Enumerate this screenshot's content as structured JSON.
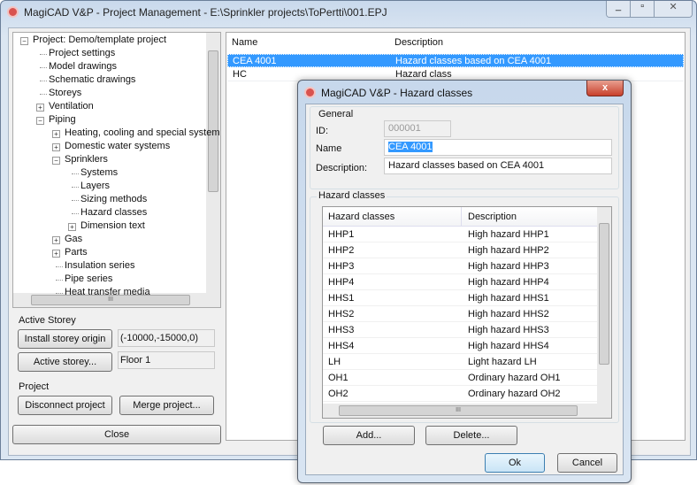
{
  "main_window": {
    "title": "MagiCAD V&P - Project Management - E:\\Sprinkler projects\\ToPertti\\001.EPJ",
    "min": "_",
    "max": "▫",
    "close": "✕"
  },
  "tree": {
    "items": [
      {
        "label": "Project: Demo/template project",
        "level": 0,
        "exp": "−"
      },
      {
        "label": "Project settings",
        "level": 1
      },
      {
        "label": "Model drawings",
        "level": 1
      },
      {
        "label": "Schematic drawings",
        "level": 1
      },
      {
        "label": "Storeys",
        "level": 1
      },
      {
        "label": "Ventilation",
        "level": 1,
        "exp": "+"
      },
      {
        "label": "Piping",
        "level": 1,
        "exp": "−"
      },
      {
        "label": "Heating, cooling and special system",
        "level": 2,
        "exp": "+"
      },
      {
        "label": "Domestic water systems",
        "level": 2,
        "exp": "+"
      },
      {
        "label": "Sprinklers",
        "level": 2,
        "exp": "−"
      },
      {
        "label": "Systems",
        "level": 3
      },
      {
        "label": "Layers",
        "level": 3
      },
      {
        "label": "Sizing methods",
        "level": 3
      },
      {
        "label": "Hazard classes",
        "level": 3
      },
      {
        "label": "Dimension text",
        "level": 3,
        "exp": "+"
      },
      {
        "label": "Gas",
        "level": 2,
        "exp": "+"
      },
      {
        "label": "Parts",
        "level": 2,
        "exp": "+"
      },
      {
        "label": "Insulation series",
        "level": 2
      },
      {
        "label": "Pipe series",
        "level": 2
      },
      {
        "label": "Heat transfer media",
        "level": 2
      }
    ],
    "hscroll_grip": "III"
  },
  "active_storey": {
    "heading": "Active Storey",
    "install_btn": "Install storey origin",
    "origin": "(-10000,-15000,0)",
    "active_btn": "Active storey...",
    "floor": "Floor 1"
  },
  "project": {
    "heading": "Project",
    "disconnect": "Disconnect project",
    "merge": "Merge project..."
  },
  "close_btn": "Close",
  "list": {
    "col_name": "Name",
    "col_desc": "Description",
    "rows": [
      {
        "name": "CEA 4001",
        "desc": "Hazard classes based on CEA 4001",
        "selected": true
      },
      {
        "name": "HC",
        "desc": "Hazard class"
      }
    ]
  },
  "dialog": {
    "title": "MagiCAD V&P - Hazard classes",
    "close": "x",
    "general": "General",
    "id_label": "ID:",
    "id_value": "000001",
    "name_label": "Name",
    "name_value": "CEA 4001",
    "desc_label": "Description:",
    "desc_value": "Hazard classes based on CEA 4001",
    "group": "Hazard classes",
    "col_class": "Hazard classes",
    "col_desc": "Description",
    "rows": [
      {
        "c": "HHP1",
        "d": "High hazard HHP1"
      },
      {
        "c": "HHP2",
        "d": "High hazard HHP2"
      },
      {
        "c": "HHP3",
        "d": "High hazard HHP3"
      },
      {
        "c": "HHP4",
        "d": "High hazard HHP4"
      },
      {
        "c": "HHS1",
        "d": "High hazard HHS1"
      },
      {
        "c": "HHS2",
        "d": "High hazard HHS2"
      },
      {
        "c": "HHS3",
        "d": "High hazard HHS3"
      },
      {
        "c": "HHS4",
        "d": "High hazard HHS4"
      },
      {
        "c": "LH",
        "d": "Light hazard LH"
      },
      {
        "c": "OH1",
        "d": "Ordinary hazard OH1"
      },
      {
        "c": "OH2",
        "d": "Ordinary hazard OH2"
      }
    ],
    "add": "Add...",
    "delete": "Delete...",
    "ok": "Ok",
    "cancel": "Cancel",
    "grip": "III"
  }
}
